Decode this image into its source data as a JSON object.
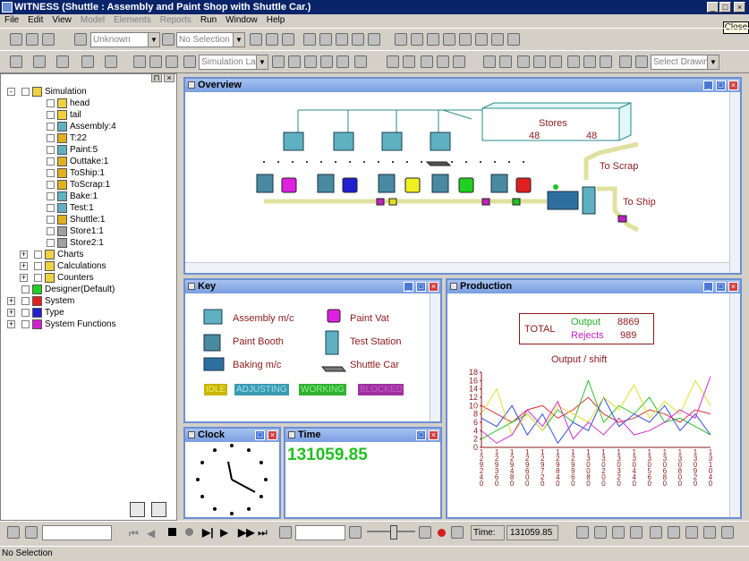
{
  "window": {
    "title": "WITNESS (Shuttle : Assembly and Paint Shop with Shuttle Car.)"
  },
  "tooltip": "Close",
  "menu": [
    {
      "label": "File",
      "enabled": true
    },
    {
      "label": "Edit",
      "enabled": true
    },
    {
      "label": "View",
      "enabled": true
    },
    {
      "label": "Model",
      "enabled": false
    },
    {
      "label": "Elements",
      "enabled": false
    },
    {
      "label": "Reports",
      "enabled": false
    },
    {
      "label": "Run",
      "enabled": true
    },
    {
      "label": "Window",
      "enabled": true
    },
    {
      "label": "Help",
      "enabled": true
    }
  ],
  "toolbar1": {
    "type_combo": "Unknown",
    "selection_combo": "No Selection"
  },
  "toolbar2": {
    "layer_combo": "Simulation Laye",
    "drawing_combo": "Select Drawing"
  },
  "tree": [
    {
      "label": "Simulation",
      "level": 0,
      "exp": "-",
      "icon": "folder"
    },
    {
      "label": "head",
      "level": 2,
      "icon": "head"
    },
    {
      "label": "tail",
      "level": 2,
      "icon": "head"
    },
    {
      "label": "Assembly:4",
      "level": 2,
      "icon": "machine"
    },
    {
      "label": "T:22",
      "level": 2,
      "icon": "part"
    },
    {
      "label": "Paint:5",
      "level": 2,
      "icon": "machine"
    },
    {
      "label": "Outtake:1",
      "level": 2,
      "icon": "conv"
    },
    {
      "label": "ToShip:1",
      "level": 2,
      "icon": "conv"
    },
    {
      "label": "ToScrap:1",
      "level": 2,
      "icon": "conv"
    },
    {
      "label": "Bake:1",
      "level": 2,
      "icon": "machine"
    },
    {
      "label": "Test:1",
      "level": 2,
      "icon": "machine"
    },
    {
      "label": "Shuttle:1",
      "level": 2,
      "icon": "conv"
    },
    {
      "label": "Store1:1",
      "level": 2,
      "icon": "store"
    },
    {
      "label": "Store2:1",
      "level": 2,
      "icon": "store"
    },
    {
      "label": "Charts",
      "level": 1,
      "exp": "+",
      "icon": "folder"
    },
    {
      "label": "Calculations",
      "level": 1,
      "exp": "+",
      "icon": "folder"
    },
    {
      "label": "Counters",
      "level": 1,
      "exp": "+",
      "icon": "folder"
    },
    {
      "label": "Designer(Default)",
      "level": 0,
      "icon": "green"
    },
    {
      "label": "System",
      "level": 0,
      "exp": "+",
      "icon": "red"
    },
    {
      "label": "Type",
      "level": 0,
      "exp": "+",
      "icon": "blue"
    },
    {
      "label": "System Functions",
      "level": 0,
      "exp": "+",
      "icon": "magenta"
    }
  ],
  "overview": {
    "title": "Overview",
    "stores_label": "Stores",
    "stores_a": "48",
    "stores_b": "48",
    "to_scrap": "To Scrap",
    "to_ship": "To Ship"
  },
  "key": {
    "title": "Key",
    "items": [
      "Assembly m/c",
      "Paint Booth",
      "Baking m/c",
      "Paint Vat",
      "Test Station",
      "Shuttle Car"
    ],
    "states": [
      {
        "label": "IDLE",
        "bg": "#c8b400",
        "fg": "#f0f070"
      },
      {
        "label": "ADJUSTING",
        "bg": "#3a9ab0",
        "fg": "#a0e0f0"
      },
      {
        "label": "WORKING",
        "bg": "#30b030",
        "fg": "#90f090"
      },
      {
        "label": "BLOCKED",
        "bg": "#a030a0",
        "fg": "#c060c0"
      }
    ]
  },
  "production": {
    "title": "Production",
    "total_label": "TOTAL",
    "output_label": "Output",
    "output_value": "8869",
    "rejects_label": "Rejects",
    "rejects_value": "989",
    "chart_title": "Output / shift"
  },
  "chart_data": {
    "type": "line",
    "title": "Output / shift",
    "ylim": [
      0,
      18
    ],
    "yticks": [
      0,
      2,
      4,
      6,
      8,
      10,
      12,
      14,
      16,
      18
    ],
    "categories": [
      "129240",
      "129360",
      "129480",
      "129600",
      "129720",
      "129840",
      "129960",
      "130080",
      "130200",
      "130320",
      "130440",
      "130560",
      "130680",
      "130800",
      "130920",
      "131040"
    ],
    "series": [
      {
        "color": "#e03030",
        "values": [
          10,
          8,
          6,
          9,
          10,
          7,
          9,
          12,
          8,
          6,
          7,
          9,
          8,
          6,
          9,
          8
        ]
      },
      {
        "color": "#30c030",
        "values": [
          2,
          4,
          6,
          8,
          4,
          9,
          6,
          16,
          6,
          10,
          8,
          12,
          6,
          7,
          5,
          3
        ]
      },
      {
        "color": "#3050e0",
        "values": [
          7,
          5,
          10,
          3,
          8,
          1,
          6,
          4,
          12,
          5,
          8,
          6,
          10,
          4,
          8,
          3
        ]
      },
      {
        "color": "#e0e030",
        "values": [
          8,
          14,
          3,
          8,
          4,
          10,
          8,
          6,
          12,
          9,
          15,
          7,
          11,
          8,
          16,
          10
        ]
      },
      {
        "color": "#d030d0",
        "values": [
          4,
          1,
          3,
          9,
          5,
          11,
          2,
          6,
          3,
          7,
          3,
          4,
          6,
          9,
          7,
          17
        ]
      }
    ]
  },
  "clock": {
    "title": "Clock"
  },
  "time": {
    "title": "Time",
    "value": "131059.85"
  },
  "bottom": {
    "time_label": "Time:",
    "time_value": "131059.85"
  },
  "status": "No Selection"
}
